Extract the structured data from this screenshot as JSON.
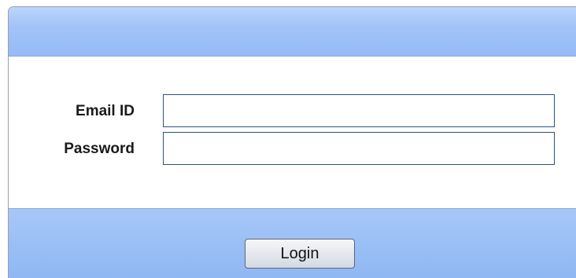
{
  "form": {
    "email_label": "Email ID",
    "email_value": "",
    "password_label": "Password",
    "password_value": ""
  },
  "footer": {
    "login_label": "Login"
  },
  "colors": {
    "header_blue": "#a1c3f8",
    "footer_blue": "#9abff6",
    "input_border": "#2e4f86"
  }
}
